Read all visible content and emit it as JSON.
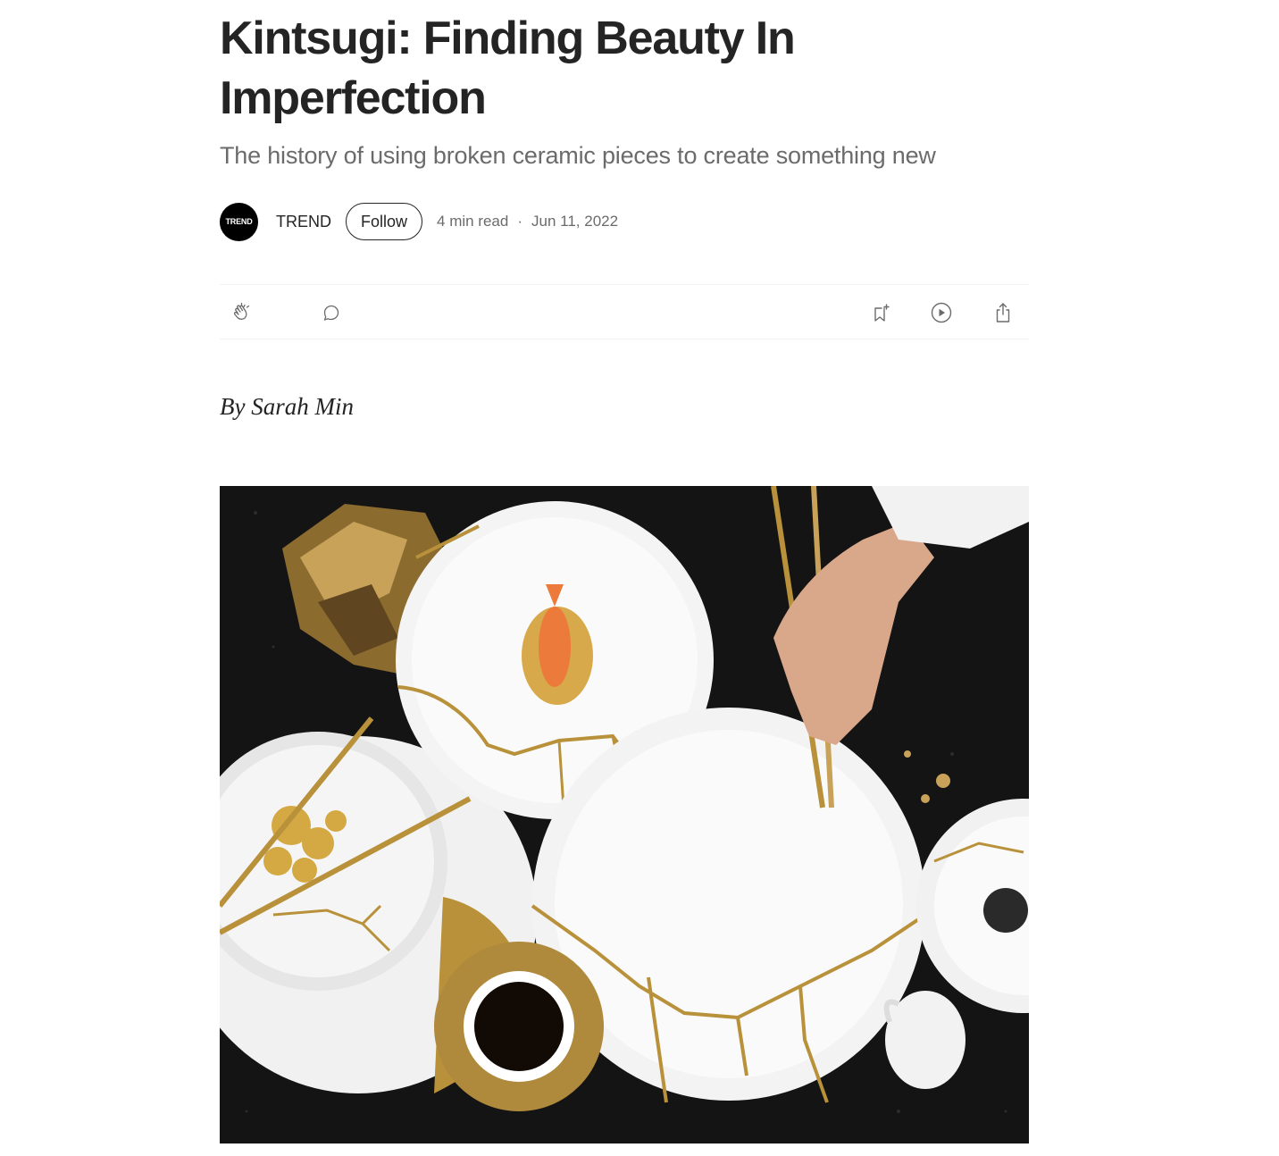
{
  "article": {
    "title": "Kintsugi: Finding Beauty In Imperfection",
    "subtitle": "The history of using broken ceramic pieces to create something new",
    "author_credit": "By Sarah Min"
  },
  "byline": {
    "avatar_text": "TREND",
    "publication": "TREND",
    "follow_label": "Follow",
    "read_time": "4 min read",
    "separator": "·",
    "date": "Jun 11, 2022"
  },
  "actions": {
    "icons": [
      "clap-icon",
      "response-icon",
      "bookmark-add-icon",
      "play-icon",
      "share-icon"
    ]
  },
  "colors": {
    "text": "#242424",
    "muted": "#6b6b6b",
    "gold": "#b8913a",
    "dark_table": "#141414"
  }
}
